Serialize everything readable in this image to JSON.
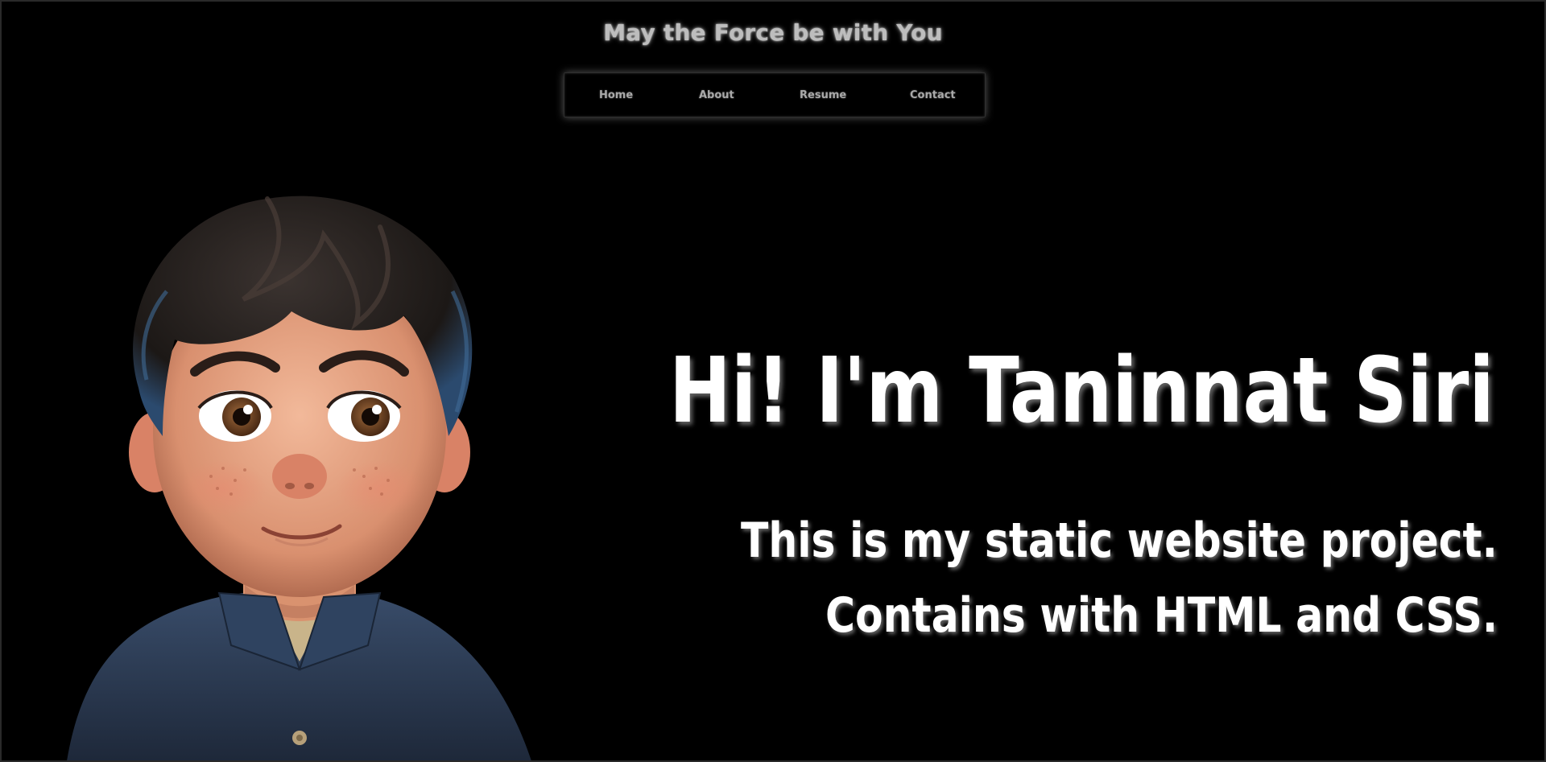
{
  "header": {
    "title": "May the Force be with You"
  },
  "nav": {
    "items": [
      {
        "label": "Home"
      },
      {
        "label": "About"
      },
      {
        "label": "Resume"
      },
      {
        "label": "Contact"
      }
    ]
  },
  "hero": {
    "name": "Hi! I'm Taninnat Siri",
    "line1": "This is my static website project.",
    "line2": "Contains with HTML and CSS."
  },
  "colors": {
    "background": "#000000",
    "text": "#ffffff",
    "nav_text": "#a9a9a9"
  }
}
